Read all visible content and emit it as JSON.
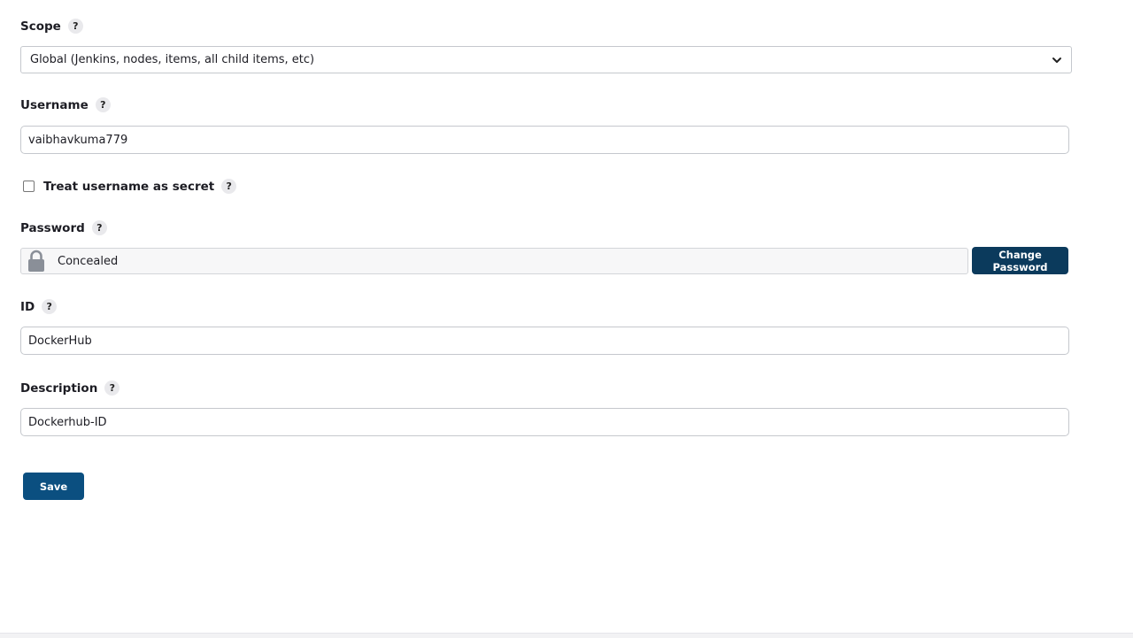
{
  "form": {
    "scope": {
      "label": "Scope",
      "help": "?",
      "selected": "Global (Jenkins, nodes, items, all child items, etc)"
    },
    "username": {
      "label": "Username",
      "help": "?",
      "value": "vaibhavkuma779"
    },
    "treat_secret": {
      "label": "Treat username as secret",
      "help": "?",
      "checked": false
    },
    "password": {
      "label": "Password",
      "help": "?",
      "concealed_text": "Concealed",
      "change_button": "Change Password"
    },
    "id": {
      "label": "ID",
      "help": "?",
      "value": "DockerHub"
    },
    "description": {
      "label": "Description",
      "help": "?",
      "value": "Dockerhub-ID"
    },
    "save_button": "Save"
  },
  "colors": {
    "primary_button": "#0b4f80",
    "change_password_button": "#0b3a5c",
    "lock_icon": "#8a8f98"
  },
  "icons": {
    "select_arrow": "chevron-down-icon",
    "password_lock": "lock-icon",
    "help": "question-mark-icon"
  }
}
